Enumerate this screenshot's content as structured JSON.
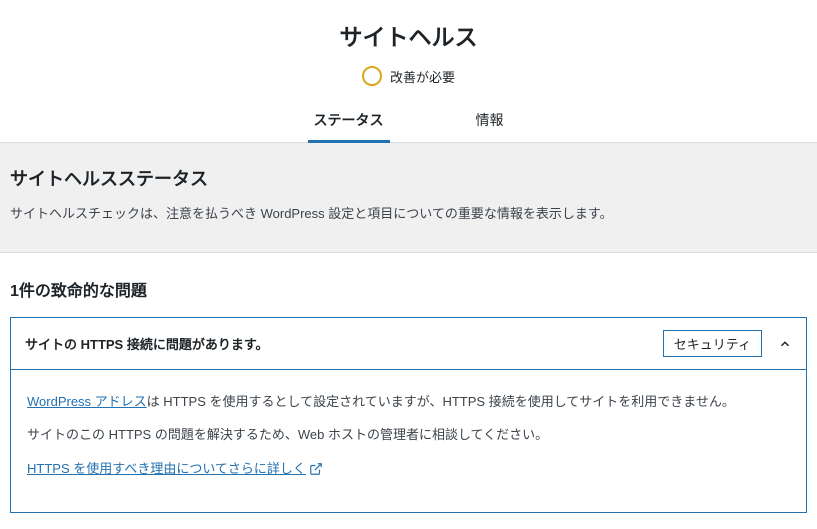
{
  "title": "サイトヘルス",
  "indicator": {
    "label": "改善が必要",
    "color": "#dba617"
  },
  "tabs": {
    "status": "ステータス",
    "info": "情報"
  },
  "status": {
    "heading": "サイトヘルスステータス",
    "desc": "サイトヘルスチェックは、注意を払うべき WordPress 設定と項目についての重要な情報を表示します。"
  },
  "issues": {
    "critical_heading": "1件の致命的な問題",
    "items": [
      {
        "title": "サイトの HTTPS 接続に問題があります。",
        "badge": "セキュリティ",
        "p1a": "WordPress アドレス",
        "p1b": "は HTTPS を使用するとして設定されていますが、HTTPS 接続を使用してサイトを利用できません。",
        "p2": "サイトのこの HTTPS の問題を解決するため、Web ホストの管理者に相談してください。",
        "link": "HTTPS を使用すべき理由についてさらに詳しく"
      }
    ]
  }
}
